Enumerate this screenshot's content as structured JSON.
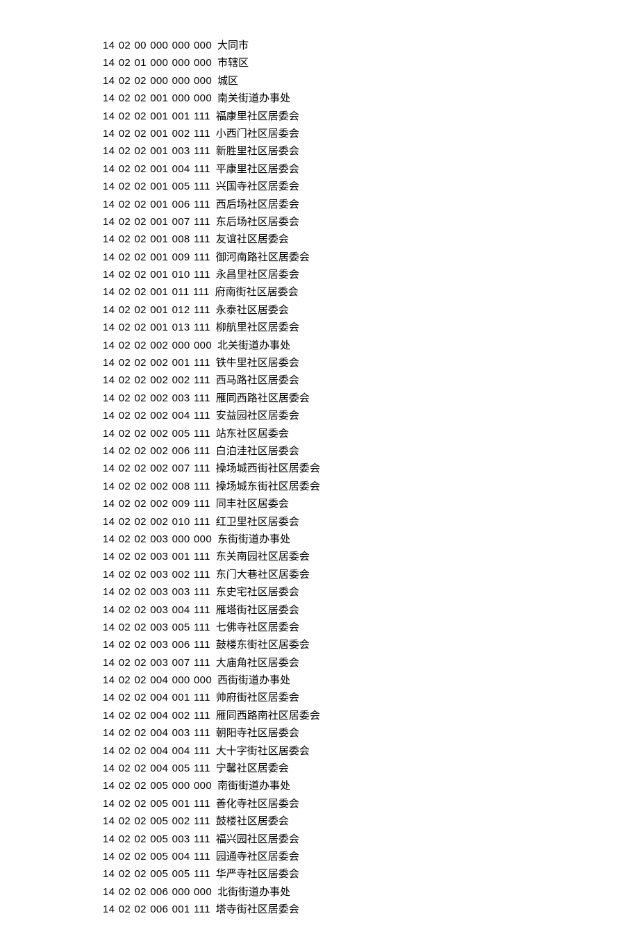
{
  "rows": [
    {
      "code": "14 02 00 000 000 000",
      "name": "大同市"
    },
    {
      "code": "14 02 01 000 000 000",
      "name": "市辖区"
    },
    {
      "code": "14 02 02 000 000 000",
      "name": "城区"
    },
    {
      "code": "14 02 02 001 000 000",
      "name": "南关街道办事处"
    },
    {
      "code": "14 02 02 001 001 111",
      "name": "福康里社区居委会"
    },
    {
      "code": "14 02 02 001 002 111",
      "name": "小西门社区居委会"
    },
    {
      "code": "14 02 02 001 003 111",
      "name": "新胜里社区居委会"
    },
    {
      "code": "14 02 02 001 004 111",
      "name": "平康里社区居委会"
    },
    {
      "code": "14 02 02 001 005 111",
      "name": "兴国寺社区居委会"
    },
    {
      "code": "14 02 02 001 006 111",
      "name": "西后场社区居委会"
    },
    {
      "code": "14 02 02 001 007 111",
      "name": "东后场社区居委会"
    },
    {
      "code": "14 02 02 001 008 111",
      "name": "友谊社区居委会"
    },
    {
      "code": "14 02 02 001 009 111",
      "name": "御河南路社区居委会"
    },
    {
      "code": "14 02 02 001 010 111",
      "name": "永昌里社区居委会"
    },
    {
      "code": "14 02 02 001 011 111",
      "name": "府南街社区居委会"
    },
    {
      "code": "14 02 02 001 012 111",
      "name": "永泰社区居委会"
    },
    {
      "code": "14 02 02 001 013 111",
      "name": "柳航里社区居委会"
    },
    {
      "code": "14 02 02 002 000 000",
      "name": "北关街道办事处"
    },
    {
      "code": "14 02 02 002 001 111",
      "name": "铁牛里社区居委会"
    },
    {
      "code": "14 02 02 002 002 111",
      "name": "西马路社区居委会"
    },
    {
      "code": "14 02 02 002 003 111",
      "name": "雁同西路社区居委会"
    },
    {
      "code": "14 02 02 002 004 111",
      "name": "安益园社区居委会"
    },
    {
      "code": "14 02 02 002 005 111",
      "name": "站东社区居委会"
    },
    {
      "code": "14 02 02 002 006 111",
      "name": "白泊洼社区居委会"
    },
    {
      "code": "14 02 02 002 007 111",
      "name": "操场城西街社区居委会"
    },
    {
      "code": "14 02 02 002 008 111",
      "name": "操场城东街社区居委会"
    },
    {
      "code": "14 02 02 002 009 111",
      "name": "同丰社区居委会"
    },
    {
      "code": "14 02 02 002 010 111",
      "name": "红卫里社区居委会"
    },
    {
      "code": "14 02 02 003 000 000",
      "name": "东街街道办事处"
    },
    {
      "code": "14 02 02 003 001 111",
      "name": "东关南园社区居委会"
    },
    {
      "code": "14 02 02 003 002 111",
      "name": "东门大巷社区居委会"
    },
    {
      "code": "14 02 02 003 003 111",
      "name": "东史宅社区居委会"
    },
    {
      "code": "14 02 02 003 004 111",
      "name": "雁塔街社区居委会"
    },
    {
      "code": "14 02 02 003 005 111",
      "name": "七佛寺社区居委会"
    },
    {
      "code": "14 02 02 003 006 111",
      "name": "鼓楼东街社区居委会"
    },
    {
      "code": "14 02 02 003 007 111",
      "name": "大庙角社区居委会"
    },
    {
      "code": "14 02 02 004 000 000",
      "name": "西街街道办事处"
    },
    {
      "code": "14 02 02 004 001 111",
      "name": "帅府街社区居委会"
    },
    {
      "code": "14 02 02 004 002 111",
      "name": "雁同西路南社区居委会"
    },
    {
      "code": "14 02 02 004 003 111",
      "name": "朝阳寺社区居委会"
    },
    {
      "code": "14 02 02 004 004 111",
      "name": "大十字街社区居委会"
    },
    {
      "code": "14 02 02 004 005 111",
      "name": "宁馨社区居委会"
    },
    {
      "code": "14 02 02 005 000 000",
      "name": "南街街道办事处"
    },
    {
      "code": "14 02 02 005 001 111",
      "name": "善化寺社区居委会"
    },
    {
      "code": "14 02 02 005 002 111",
      "name": "鼓楼社区居委会"
    },
    {
      "code": "14 02 02 005 003 111",
      "name": "福兴园社区居委会"
    },
    {
      "code": "14 02 02 005 004 111",
      "name": "园通寺社区居委会"
    },
    {
      "code": "14 02 02 005 005 111",
      "name": "华严寺社区居委会"
    },
    {
      "code": "14 02 02 006 000 000",
      "name": "北街街道办事处"
    },
    {
      "code": "14 02 02 006 001 111",
      "name": "塔寺街社区居委会"
    }
  ]
}
